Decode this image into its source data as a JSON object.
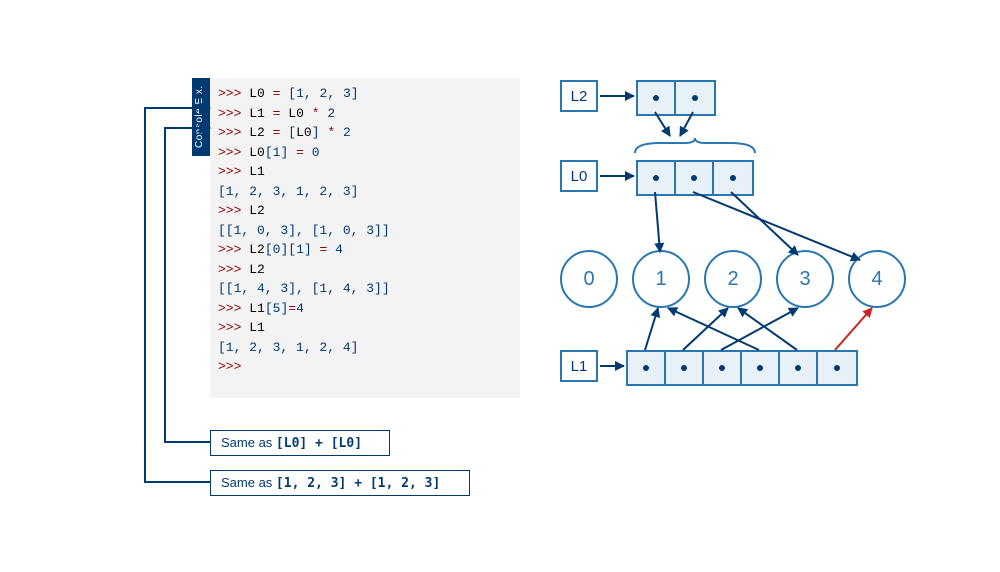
{
  "console_tab": "Console E x.",
  "console_lines": [
    {
      "type": "in",
      "raw": ">>> L0 = [1, 2, 3]"
    },
    {
      "type": "in",
      "raw": ">>> L1 = L0 * 2"
    },
    {
      "type": "in",
      "raw": ">>> L2 = [L0] * 2"
    },
    {
      "type": "in",
      "raw": ">>> L0[1] = 0"
    },
    {
      "type": "in",
      "raw": ">>> L1"
    },
    {
      "type": "out",
      "raw": "[1, 2, 3, 1, 2, 3]"
    },
    {
      "type": "in",
      "raw": ">>> L2"
    },
    {
      "type": "out",
      "raw": "[[1, 0, 3], [1, 0, 3]]"
    },
    {
      "type": "in",
      "raw": ">>> L2[0][1] = 4"
    },
    {
      "type": "in",
      "raw": ">>> L2"
    },
    {
      "type": "out",
      "raw": "[[1, 4, 3], [1, 4, 3]]"
    },
    {
      "type": "in",
      "raw": ">>> L1[5]=4"
    },
    {
      "type": "in",
      "raw": ">>> L1"
    },
    {
      "type": "out",
      "raw": "[1, 2, 3, 1, 2, 4]"
    },
    {
      "type": "in",
      "raw": ">>> "
    }
  ],
  "annot1_prefix": "Same as ",
  "annot1_code": "[L0] + [L0]",
  "annot2_prefix": "Same as ",
  "annot2_code": "[1, 2, 3] + [1, 2, 3]",
  "labels": {
    "L0": "L0",
    "L1": "L1",
    "L2": "L2"
  },
  "values": [
    "0",
    "1",
    "2",
    "3",
    "4"
  ]
}
